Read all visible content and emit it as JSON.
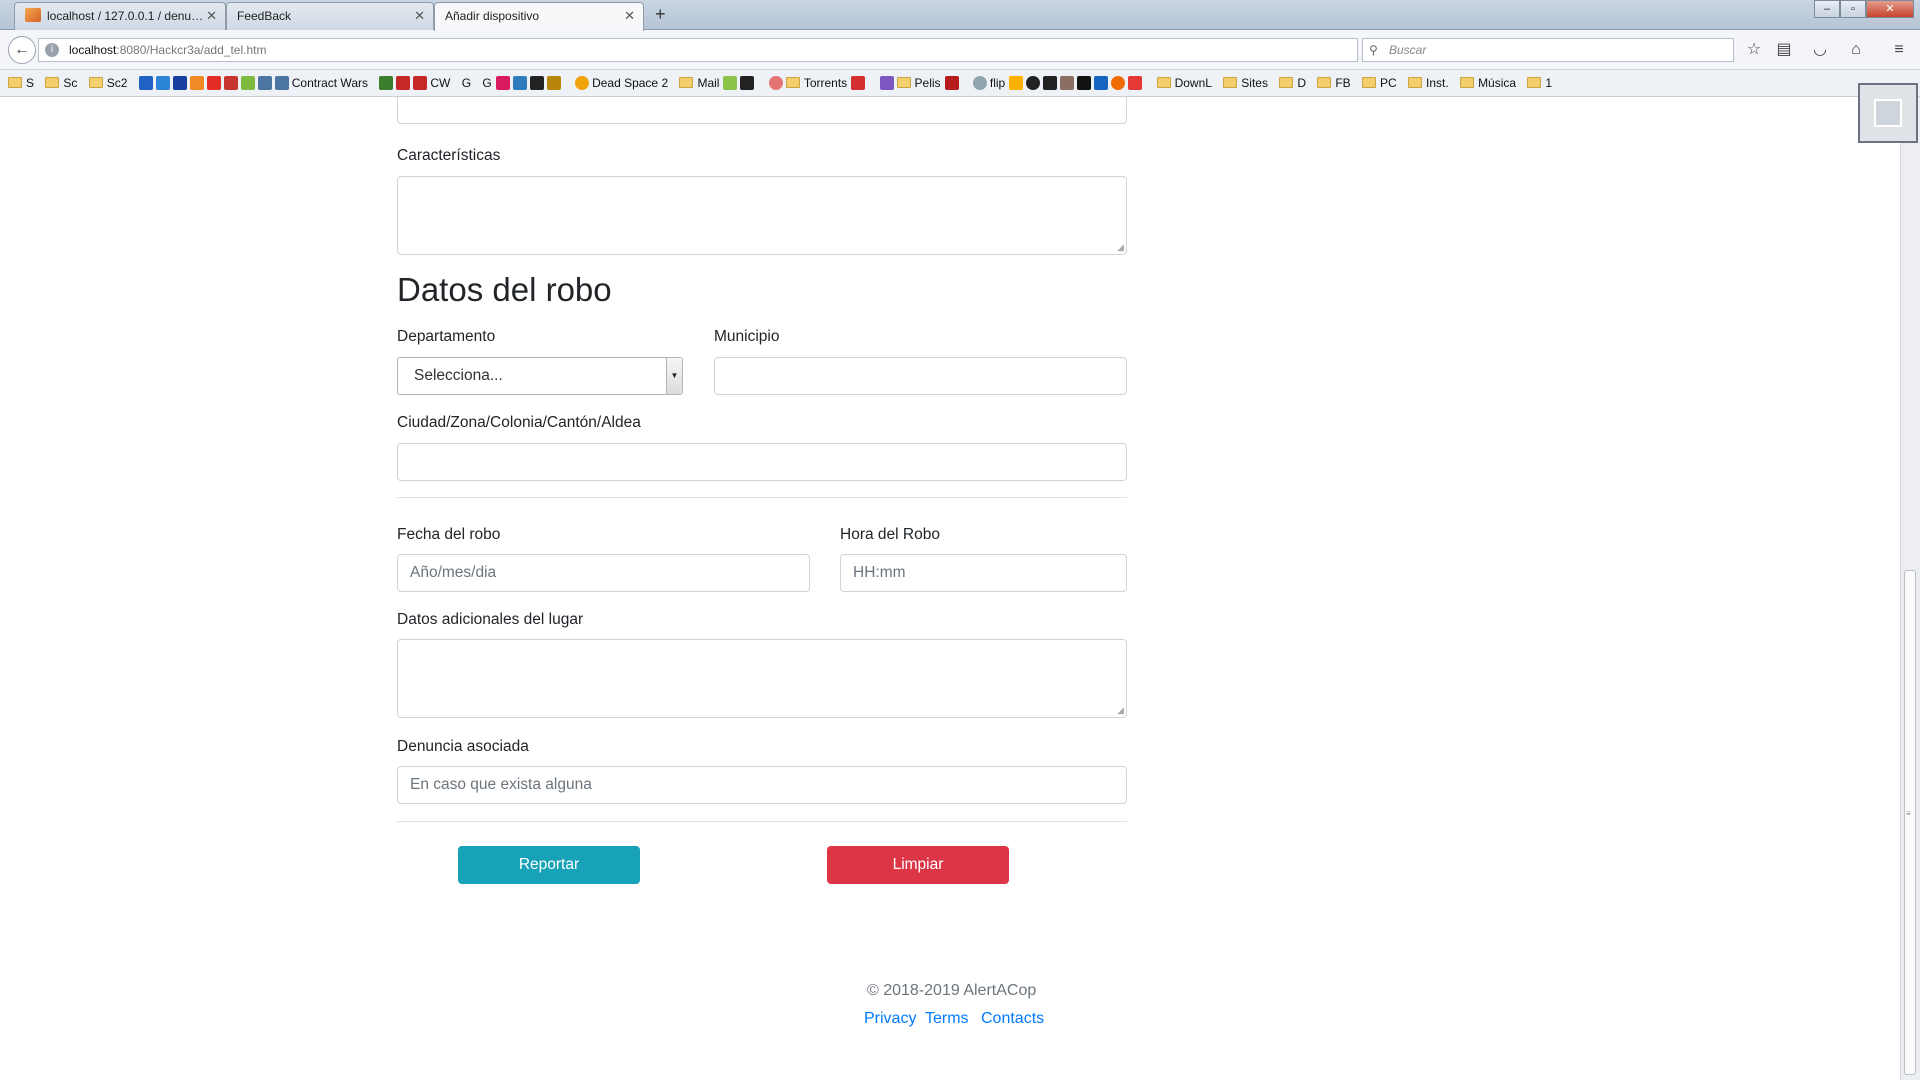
{
  "browser": {
    "tabs": [
      {
        "title": "localhost / 127.0.0.1 / denu…",
        "active": false
      },
      {
        "title": "FeedBack",
        "active": false
      },
      {
        "title": "Añadir dispositivo",
        "active": true
      }
    ],
    "new_tab": "+",
    "url_host": "localhost",
    "url_path": ":8080/Hackcr3a/add_tel.htm",
    "search_placeholder": "Buscar",
    "window_buttons": {
      "minimize": "–",
      "restore": "▫",
      "close": "✕"
    },
    "bookmarks": [
      {
        "label": "S",
        "type": "folder"
      },
      {
        "label": "Sc",
        "type": "folder"
      },
      {
        "label": "Sc2",
        "type": "folder"
      },
      {
        "label": "Contract Wars",
        "type": "site"
      },
      {
        "label": "CW",
        "type": "site"
      },
      {
        "label": "G",
        "type": "site"
      },
      {
        "label": "G",
        "type": "site"
      },
      {
        "label": "Dead Space 2",
        "type": "site"
      },
      {
        "label": "Mail",
        "type": "folder"
      },
      {
        "label": "Torrents",
        "type": "folder"
      },
      {
        "label": "Pelis",
        "type": "folder"
      },
      {
        "label": "flip",
        "type": "site"
      },
      {
        "label": "DownL",
        "type": "folder"
      },
      {
        "label": "Sites",
        "type": "folder"
      },
      {
        "label": "D",
        "type": "folder"
      },
      {
        "label": "FB",
        "type": "folder"
      },
      {
        "label": "PC",
        "type": "folder"
      },
      {
        "label": "Inst.",
        "type": "folder"
      },
      {
        "label": "Música",
        "type": "folder"
      },
      {
        "label": "1",
        "type": "folder"
      }
    ]
  },
  "form": {
    "caracteristicas_label": "Características",
    "section_title": "Datos del robo",
    "departamento_label": "Departamento",
    "departamento_value": "Selecciona...",
    "municipio_label": "Municipio",
    "ciudad_label": "Ciudad/Zona/Colonia/Cantón/Aldea",
    "fecha_label": "Fecha del robo",
    "fecha_placeholder": "Año/mes/dia",
    "hora_label": "Hora del Robo",
    "hora_placeholder": "HH:mm",
    "datos_adicionales_label": "Datos adicionales del lugar",
    "denuncia_label": "Denuncia asociada",
    "denuncia_placeholder": "En caso que exista alguna",
    "submit_label": "Reportar",
    "clear_label": "Limpiar"
  },
  "colors": {
    "submit": "#17a2b8",
    "clear": "#dc3545",
    "link": "#007bff"
  },
  "footer": {
    "copyright": "© 2018-2019 AlertACop",
    "links": [
      "Privacy",
      "Terms",
      "Contacts"
    ]
  }
}
